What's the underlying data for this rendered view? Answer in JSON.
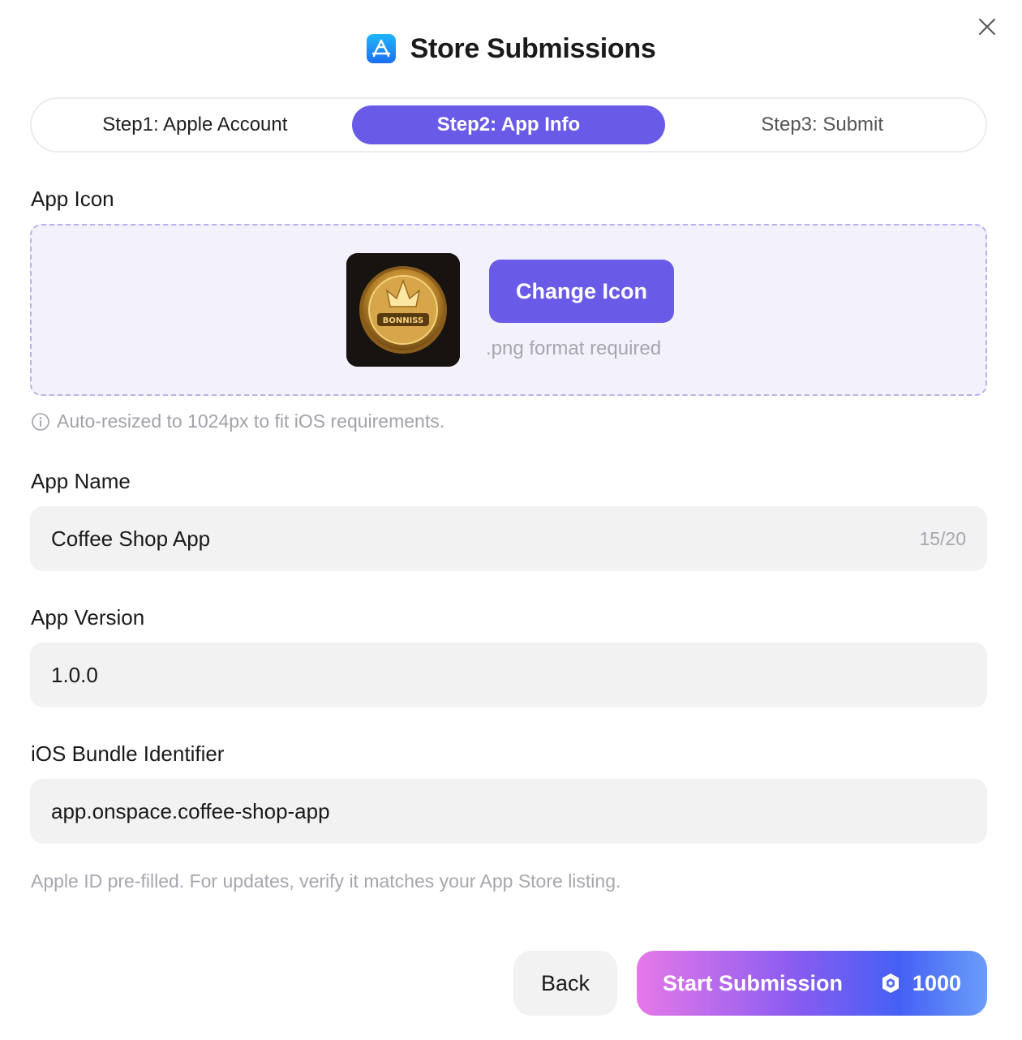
{
  "dialog": {
    "title": "Store Submissions",
    "close_icon": "close-icon",
    "title_icon": "app-store-icon"
  },
  "steps": [
    {
      "label": "Step1: Apple Account",
      "state": "completed"
    },
    {
      "label": "Step2: App Info",
      "state": "active"
    },
    {
      "label": "Step3: Submit",
      "state": "upcoming"
    }
  ],
  "app_icon": {
    "label": "App Icon",
    "change_button": "Change Icon",
    "format_hint": ".png format required",
    "resize_note": "Auto-resized to 1024px to fit iOS requirements.",
    "preview_text": "BONNISS"
  },
  "app_name": {
    "label": "App Name",
    "value": "Coffee Shop App",
    "counter": "15/20"
  },
  "app_version": {
    "label": "App Version",
    "value": "1.0.0"
  },
  "bundle_id": {
    "label": "iOS Bundle Identifier",
    "value": "app.onspace.coffee-shop-app"
  },
  "footnote": "Apple ID pre-filled. For updates, verify it matches your App Store listing.",
  "actions": {
    "back": "Back",
    "submit": "Start Submission",
    "credit_cost": "1000",
    "credit_icon": "credit-icon"
  },
  "colors": {
    "accent": "#6a5ae8",
    "dropzone_bg": "#f2f1fc",
    "field_bg": "#f2f2f3"
  }
}
